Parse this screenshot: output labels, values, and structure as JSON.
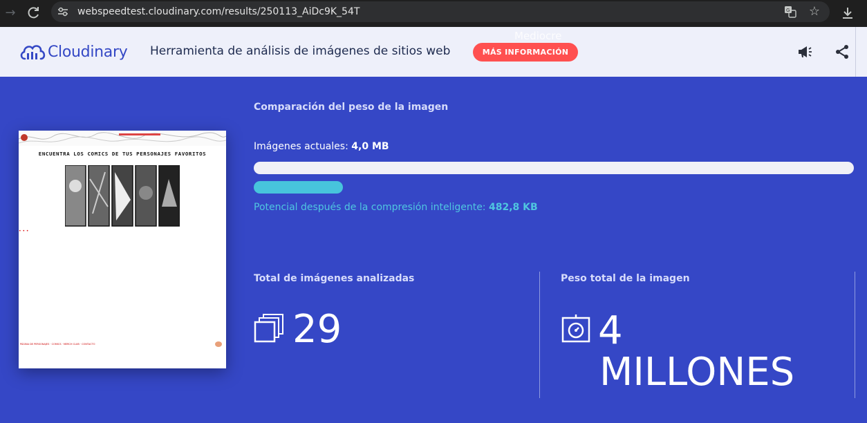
{
  "browser": {
    "url": "webspeedtest.cloudinary.com/results/250113_AiDc9K_54T",
    "back_icon": "→",
    "reload_icon": "C",
    "star_icon": "☆"
  },
  "header": {
    "logo_text": "Cloudinary",
    "tool_title": "Herramienta de análisis de imágenes de sitios web",
    "more_button": "MÁS INFORMACIÓN",
    "rating_overlay": "Mediocre"
  },
  "thumbnail": {
    "heading": "ENCUENTRA LOS COMICS DE TUS PERSONAJES FAVORITOS",
    "footer_links": "PÁGINA DE PERSONAJES · COMICS · MERCH CLUB · CONTACTO"
  },
  "comparison": {
    "title": "Comparación del peso de la imagen",
    "current_label": "Imágenes actuales:",
    "current_value": "4,0 MB",
    "potential_label": "Potencial después de la compresión inteligente:",
    "potential_value": "482,8 KB",
    "potential_ratio": 0.149
  },
  "stats": {
    "images_label": "Total de imágenes analizadas",
    "images_value": "29",
    "weight_label": "Peso total de la imagen",
    "weight_value_line1": "4",
    "weight_value_line2": "MILLONES"
  },
  "colors": {
    "page_bg": "#3547c6",
    "accent_cyan": "#47c4dc",
    "button_red": "#ff5050",
    "brand_blue": "#3448c5"
  }
}
